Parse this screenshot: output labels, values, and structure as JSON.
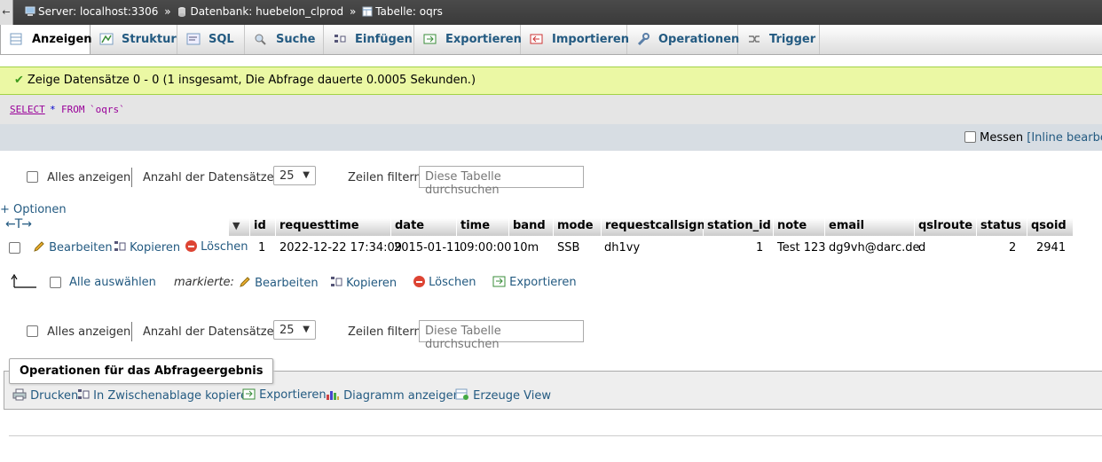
{
  "breadcrumb": {
    "server": "Server: localhost:3306",
    "database": "Datenbank: huebelon_clprod",
    "table": "Tabelle: oqrs",
    "separator": "»",
    "back": "←"
  },
  "tabs": [
    {
      "label": "Anzeigen",
      "icon": "table-browse-icon"
    },
    {
      "label": "Struktur",
      "icon": "structure-icon"
    },
    {
      "label": "SQL",
      "icon": "sql-icon"
    },
    {
      "label": "Suche",
      "icon": "search-icon"
    },
    {
      "label": "Einfügen",
      "icon": "insert-icon"
    },
    {
      "label": "Exportieren",
      "icon": "export-icon"
    },
    {
      "label": "Importieren",
      "icon": "import-icon"
    },
    {
      "label": "Operationen",
      "icon": "wrench-icon"
    },
    {
      "label": "Trigger",
      "icon": "trigger-icon"
    }
  ],
  "message": {
    "icon": "check-icon",
    "text": "Zeige Datensätze 0 - 0 (1 insgesamt, Die Abfrage dauerte 0.0005 Sekunden.)"
  },
  "sql": {
    "select": "SELECT",
    "star": "*",
    "from": "FROM",
    "table": "`oqrs`",
    "profiling_label": "Messen",
    "inline_edit": "[Inline bearbeit"
  },
  "controls": {
    "show_all": "Alles anzeigen",
    "rows_label": "Anzahl der Datensätze:",
    "rows_value": "25",
    "filter_label": "Zeilen filtern:",
    "filter_placeholder": "Diese Tabelle durchsuchen",
    "options_link": "+ Optionen",
    "arrows": "←T→"
  },
  "table": {
    "columns": [
      "id",
      "requesttime",
      "date",
      "time",
      "band",
      "mode",
      "requestcallsign",
      "station_id",
      "note",
      "email",
      "qslroute",
      "status",
      "qsoid"
    ],
    "row_actions": {
      "edit": "Bearbeiten",
      "copy": "Kopieren",
      "delete": "Löschen"
    },
    "rows": [
      {
        "id": "1",
        "requesttime": "2022-12-22 17:34:09",
        "date": "2015-01-11",
        "time": "09:00:00",
        "band": "10m",
        "mode": "SSB",
        "requestcallsign": "dh1vy",
        "station_id": "1",
        "note": "Test 123",
        "email": "dg9vh@darc.de",
        "qslroute": "d",
        "status": "2",
        "qsoid": "2941"
      }
    ]
  },
  "selection": {
    "select_all": "Alle auswählen",
    "marked": "markierte:",
    "edit": "Bearbeiten",
    "copy": "Kopieren",
    "delete": "Löschen",
    "export": "Exportieren"
  },
  "query_ops": {
    "legend": "Operationen für das Abfrageergebnis",
    "print": "Drucken",
    "clipboard": "In Zwischenablage kopieren",
    "export": "Exportieren",
    "chart": "Diagramm anzeigen",
    "view": "Erzeuge View"
  }
}
